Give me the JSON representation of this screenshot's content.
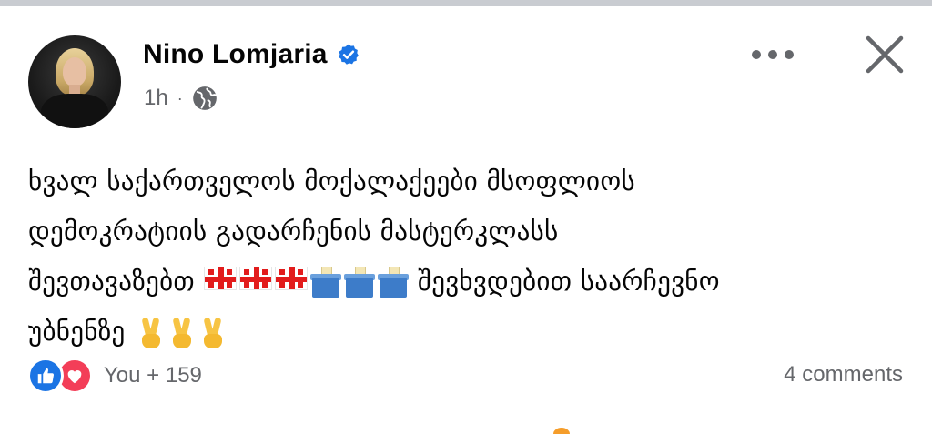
{
  "post": {
    "author": "Nino Lomjaria",
    "time": "1h",
    "separator": "·",
    "privacy_icon": "globe-icon",
    "text_lines": [
      "ხვალ საქართველოს მოქალაქეები მსოფლიოს",
      "დემოკრატიის გადარჩენის მასტერკლასს",
      "შევთავაზებთ",
      "შევხვდებით საარჩევნო",
      "უბნენზე"
    ],
    "emojis": {
      "flags": [
        "🇬🇪",
        "🇬🇪",
        "🇬🇪"
      ],
      "ballots": [
        "🗳",
        "🗳",
        "🗳"
      ],
      "victory": [
        "✌",
        "✌",
        "✌"
      ]
    }
  },
  "footer": {
    "reaction_count": "You + 159",
    "comments": "4 comments"
  },
  "colors": {
    "like": "#1b74e4",
    "love": "#f33e58",
    "secondary_text": "#65676b",
    "verified": "#1b74e4"
  }
}
